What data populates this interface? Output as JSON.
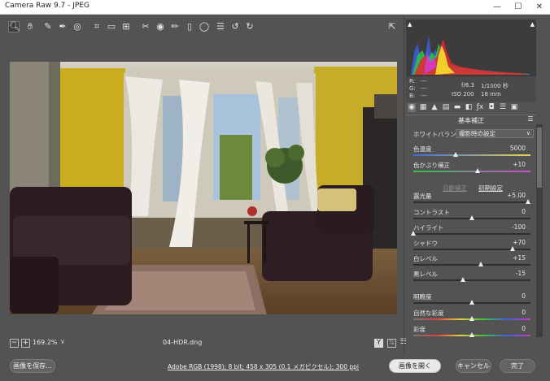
{
  "window": {
    "title": "Camera Raw 9.7 - JPEG",
    "minimize": "—",
    "maximize": "☐",
    "close": "✕"
  },
  "toolbar": {
    "tools": [
      {
        "name": "zoom-tool",
        "glyph": "🔍︎"
      },
      {
        "name": "hand-tool",
        "glyph": "✋︎"
      },
      {
        "name": "white-balance-tool",
        "glyph": "✎"
      },
      {
        "name": "color-sampler-tool",
        "glyph": "✒"
      },
      {
        "name": "targeted-adjustment-tool",
        "glyph": "◎"
      },
      {
        "name": "crop-tool",
        "glyph": "⌗"
      },
      {
        "name": "straighten-tool",
        "glyph": "▭"
      },
      {
        "name": "transform-tool",
        "glyph": "⊞"
      },
      {
        "name": "spot-removal-tool",
        "glyph": "✂"
      },
      {
        "name": "red-eye-tool",
        "glyph": "◉"
      },
      {
        "name": "adjustment-brush-tool",
        "glyph": "✏"
      },
      {
        "name": "graduated-filter-tool",
        "glyph": "▯"
      },
      {
        "name": "radial-filter-tool",
        "glyph": "◯"
      },
      {
        "name": "preferences-button",
        "glyph": "☰"
      },
      {
        "name": "rotate-left-button",
        "glyph": "↺"
      },
      {
        "name": "rotate-right-button",
        "glyph": "↻"
      }
    ],
    "fullscreen": "⇱"
  },
  "photo_bar": {
    "zoom_out": "−",
    "zoom_in": "+",
    "zoom_level": "169.2%",
    "zoom_caret": "∨",
    "filename": "04-HDR.dng"
  },
  "histogram": {
    "r_label": "R:",
    "g_label": "G:",
    "b_label": "B:",
    "r_value": "---",
    "g_value": "---",
    "b_value": "---",
    "aperture": "f/6.3",
    "shutter": "1/1000 秒",
    "iso": "ISO 200",
    "focal": "18 mm"
  },
  "panel": {
    "title": "基本補正",
    "wb_label": "ホワイトバランス：",
    "wb_value": "撮影時の設定",
    "auto": "自動補正",
    "default": "初期設定",
    "sliders": [
      {
        "label": "色温度",
        "value": "5000",
        "pos": 0.36
      },
      {
        "label": "色かぶり補正",
        "value": "+10",
        "pos": 0.55
      },
      {
        "label": "露光量",
        "value": "+5.00",
        "pos": 0.98
      },
      {
        "label": "コントラスト",
        "value": "0",
        "pos": 0.5
      },
      {
        "label": "ハイライト",
        "value": "-100",
        "pos": 0.0
      },
      {
        "label": "シャドウ",
        "value": "+70",
        "pos": 0.85
      },
      {
        "label": "白レベル",
        "value": "+15",
        "pos": 0.575
      },
      {
        "label": "黒レベル",
        "value": "-15",
        "pos": 0.425
      },
      {
        "label": "明瞭度",
        "value": "0",
        "pos": 0.5
      },
      {
        "label": "自然な彩度",
        "value": "0",
        "pos": 0.5
      },
      {
        "label": "彩度",
        "value": "0",
        "pos": 0.5
      }
    ]
  },
  "footer": {
    "save": "画像を保存...",
    "workflow": "Adobe RGB (1998); 8 bit; 458 x 305 (0.1 メガピクセル); 300 ppi",
    "open": "画像を開く",
    "cancel": "キャンセル",
    "done": "完了"
  }
}
